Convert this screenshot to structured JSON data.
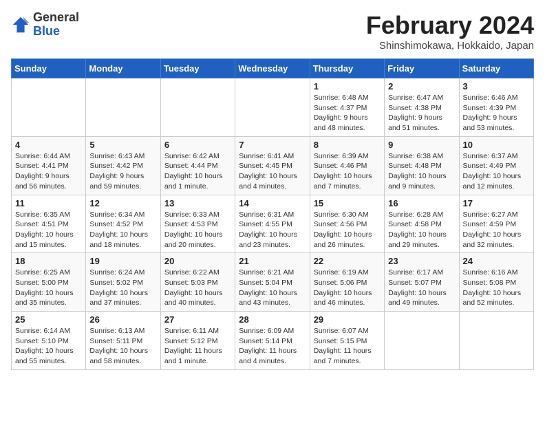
{
  "header": {
    "logo_general": "General",
    "logo_blue": "Blue",
    "month_title": "February 2024",
    "subtitle": "Shinshimokawa, Hokkaido, Japan"
  },
  "weekdays": [
    "Sunday",
    "Monday",
    "Tuesday",
    "Wednesday",
    "Thursday",
    "Friday",
    "Saturday"
  ],
  "weeks": [
    [
      {
        "day": "",
        "info": ""
      },
      {
        "day": "",
        "info": ""
      },
      {
        "day": "",
        "info": ""
      },
      {
        "day": "",
        "info": ""
      },
      {
        "day": "1",
        "info": "Sunrise: 6:48 AM\nSunset: 4:37 PM\nDaylight: 9 hours and 48 minutes."
      },
      {
        "day": "2",
        "info": "Sunrise: 6:47 AM\nSunset: 4:38 PM\nDaylight: 9 hours and 51 minutes."
      },
      {
        "day": "3",
        "info": "Sunrise: 6:46 AM\nSunset: 4:39 PM\nDaylight: 9 hours and 53 minutes."
      }
    ],
    [
      {
        "day": "4",
        "info": "Sunrise: 6:44 AM\nSunset: 4:41 PM\nDaylight: 9 hours and 56 minutes."
      },
      {
        "day": "5",
        "info": "Sunrise: 6:43 AM\nSunset: 4:42 PM\nDaylight: 9 hours and 59 minutes."
      },
      {
        "day": "6",
        "info": "Sunrise: 6:42 AM\nSunset: 4:44 PM\nDaylight: 10 hours and 1 minute."
      },
      {
        "day": "7",
        "info": "Sunrise: 6:41 AM\nSunset: 4:45 PM\nDaylight: 10 hours and 4 minutes."
      },
      {
        "day": "8",
        "info": "Sunrise: 6:39 AM\nSunset: 4:46 PM\nDaylight: 10 hours and 7 minutes."
      },
      {
        "day": "9",
        "info": "Sunrise: 6:38 AM\nSunset: 4:48 PM\nDaylight: 10 hours and 9 minutes."
      },
      {
        "day": "10",
        "info": "Sunrise: 6:37 AM\nSunset: 4:49 PM\nDaylight: 10 hours and 12 minutes."
      }
    ],
    [
      {
        "day": "11",
        "info": "Sunrise: 6:35 AM\nSunset: 4:51 PM\nDaylight: 10 hours and 15 minutes."
      },
      {
        "day": "12",
        "info": "Sunrise: 6:34 AM\nSunset: 4:52 PM\nDaylight: 10 hours and 18 minutes."
      },
      {
        "day": "13",
        "info": "Sunrise: 6:33 AM\nSunset: 4:53 PM\nDaylight: 10 hours and 20 minutes."
      },
      {
        "day": "14",
        "info": "Sunrise: 6:31 AM\nSunset: 4:55 PM\nDaylight: 10 hours and 23 minutes."
      },
      {
        "day": "15",
        "info": "Sunrise: 6:30 AM\nSunset: 4:56 PM\nDaylight: 10 hours and 26 minutes."
      },
      {
        "day": "16",
        "info": "Sunrise: 6:28 AM\nSunset: 4:58 PM\nDaylight: 10 hours and 29 minutes."
      },
      {
        "day": "17",
        "info": "Sunrise: 6:27 AM\nSunset: 4:59 PM\nDaylight: 10 hours and 32 minutes."
      }
    ],
    [
      {
        "day": "18",
        "info": "Sunrise: 6:25 AM\nSunset: 5:00 PM\nDaylight: 10 hours and 35 minutes."
      },
      {
        "day": "19",
        "info": "Sunrise: 6:24 AM\nSunset: 5:02 PM\nDaylight: 10 hours and 37 minutes."
      },
      {
        "day": "20",
        "info": "Sunrise: 6:22 AM\nSunset: 5:03 PM\nDaylight: 10 hours and 40 minutes."
      },
      {
        "day": "21",
        "info": "Sunrise: 6:21 AM\nSunset: 5:04 PM\nDaylight: 10 hours and 43 minutes."
      },
      {
        "day": "22",
        "info": "Sunrise: 6:19 AM\nSunset: 5:06 PM\nDaylight: 10 hours and 46 minutes."
      },
      {
        "day": "23",
        "info": "Sunrise: 6:17 AM\nSunset: 5:07 PM\nDaylight: 10 hours and 49 minutes."
      },
      {
        "day": "24",
        "info": "Sunrise: 6:16 AM\nSunset: 5:08 PM\nDaylight: 10 hours and 52 minutes."
      }
    ],
    [
      {
        "day": "25",
        "info": "Sunrise: 6:14 AM\nSunset: 5:10 PM\nDaylight: 10 hours and 55 minutes."
      },
      {
        "day": "26",
        "info": "Sunrise: 6:13 AM\nSunset: 5:11 PM\nDaylight: 10 hours and 58 minutes."
      },
      {
        "day": "27",
        "info": "Sunrise: 6:11 AM\nSunset: 5:12 PM\nDaylight: 11 hours and 1 minute."
      },
      {
        "day": "28",
        "info": "Sunrise: 6:09 AM\nSunset: 5:14 PM\nDaylight: 11 hours and 4 minutes."
      },
      {
        "day": "29",
        "info": "Sunrise: 6:07 AM\nSunset: 5:15 PM\nDaylight: 11 hours and 7 minutes."
      },
      {
        "day": "",
        "info": ""
      },
      {
        "day": "",
        "info": ""
      }
    ]
  ]
}
